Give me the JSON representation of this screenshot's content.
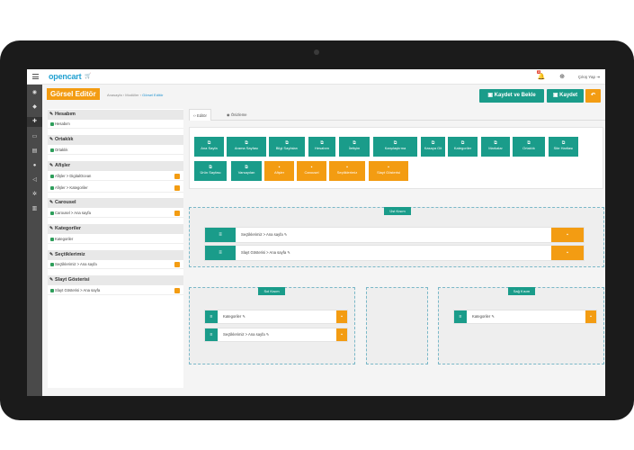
{
  "topbar": {
    "logo": "opencart",
    "notification_count": "3",
    "logout_label": "Çıkış Yap"
  },
  "header": {
    "title": "Görsel Editör",
    "breadcrumb": [
      "Anasayfa",
      "Modüller",
      "Görsel Editör"
    ],
    "save_wait_label": "Kaydet ve Bekle",
    "save_label": "Kaydet"
  },
  "left_panel": [
    {
      "heading": "Hesabım",
      "items": [
        {
          "label": "Hesabım",
          "deletable": false
        }
      ]
    },
    {
      "heading": "Ortaklık",
      "items": [
        {
          "label": "Ortaklık",
          "deletable": false
        }
      ]
    },
    {
      "heading": "Afişler",
      "items": [
        {
          "label": "Afişler > DigitalOcean",
          "deletable": true
        },
        {
          "label": "Afişler > Kategoriler",
          "deletable": true
        }
      ]
    },
    {
      "heading": "Carousel",
      "items": [
        {
          "label": "Carousel > Ana sayfa",
          "deletable": true
        }
      ]
    },
    {
      "heading": "Kategoriler",
      "items": [
        {
          "label": "Kategoriler",
          "deletable": false
        }
      ]
    },
    {
      "heading": "Seçtiklerimiz",
      "items": [
        {
          "label": "Seçtiklerimiz > Ana sayfa",
          "deletable": true
        }
      ]
    },
    {
      "heading": "Slayt Gösterisi",
      "items": [
        {
          "label": "Slayt Gösterisi > Ana sayfa",
          "deletable": true
        }
      ]
    }
  ],
  "tabs": [
    {
      "label": "Editör",
      "active": true
    },
    {
      "label": "Önizleme",
      "active": false
    }
  ],
  "modules_row1": [
    "Ana Sayfa",
    "Arama Sayfası",
    "Bilgi Sayfaları",
    "Hesabım",
    "İletişim",
    "Karşılaştırma",
    "Kasaya Git",
    "Kategoriler",
    "Markalar",
    "Ortaklık",
    "Site Haritası"
  ],
  "modules_row2": [
    {
      "label": "Ürün Sayfası",
      "color": "teal"
    },
    {
      "label": "Varsayılan",
      "color": "teal"
    },
    {
      "label": "Afişler",
      "color": "orange"
    },
    {
      "label": "Carousel",
      "color": "orange"
    },
    {
      "label": "Seçtiklerimiz",
      "color": "orange"
    },
    {
      "label": "Slayt Gösterisi",
      "color": "orange"
    }
  ],
  "zones": {
    "top": {
      "label": "Üst Kısım",
      "rows": [
        "Seçtiklerimiz > Ana sayfa",
        "Slayt Gösterisi > Ana sayfa"
      ]
    },
    "left": {
      "label": "Sol Kısım",
      "rows": [
        "Kategoriler",
        "Seçtiklerimiz > Ana sayfa"
      ]
    },
    "right": {
      "label": "Sağ Kısım",
      "rows": [
        "Kategoriler"
      ]
    }
  },
  "colors": {
    "teal": "#1a9c8a",
    "orange": "#f39c12",
    "brand_blue": "#23a1d1"
  }
}
